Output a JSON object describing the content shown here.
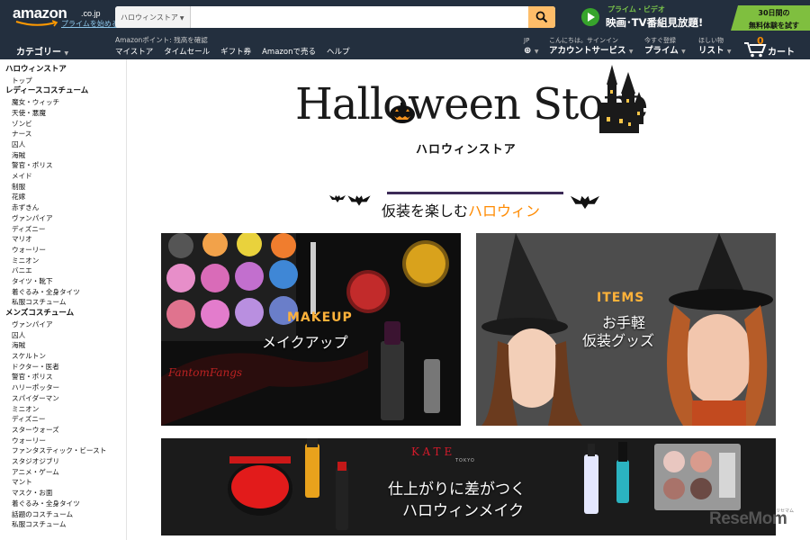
{
  "header": {
    "logo_text": "amazon",
    "logo_suffix": ".co.jp",
    "logo_prime_link": "プライムを始める",
    "search": {
      "category": "ハロウィンストア",
      "placeholder": ""
    },
    "prime_video": {
      "line1": "プライム・ビデオ",
      "line2": "映画･TV番組見放題!"
    },
    "trial": {
      "line1": "30日間の",
      "line2": "無料体験を試す"
    }
  },
  "subnav": {
    "category_label": "カテゴリー",
    "points_text": "Amazonポイント: 残高を確認",
    "links": [
      "マイストア",
      "タイムセール",
      "ギフト券",
      "Amazonで売る",
      "ヘルプ"
    ],
    "lang": {
      "line1": "JP",
      "line2": ""
    },
    "account": {
      "line1": "こんにちは。サインイン",
      "line2": "アカウントサービス"
    },
    "prime": {
      "line1": "今すぐ登録",
      "line2": "プライム"
    },
    "wishlist": {
      "line1": "ほしい物",
      "line2": "リスト"
    },
    "cart": {
      "count": "0",
      "label": "カート"
    }
  },
  "sidebar": {
    "sections": [
      {
        "title": "ハロウィンストア",
        "items": [
          "トップ"
        ]
      },
      {
        "title": "レディースコスチューム",
        "items": [
          "魔女・ウィッチ",
          "天使・悪魔",
          "ゾンビ",
          "ナース",
          "囚人",
          "海賊",
          "警官・ポリス",
          "メイド",
          "制服",
          "花嫁",
          "赤ずきん",
          "ヴァンパイア",
          "ディズニー",
          "マリオ",
          "ウォーリー",
          "ミニオン",
          "バニエ",
          "タイツ・靴下",
          "着ぐるみ・全身タイツ",
          "私服コスチューム"
        ]
      },
      {
        "title": "メンズコスチューム",
        "items": [
          "ヴァンパイア",
          "囚人",
          "海賊",
          "スケルトン",
          "ドクター・医者",
          "警官・ポリス",
          "ハリーポッター",
          "スパイダーマン",
          "ミニオン",
          "ディズニー",
          "スターウォーズ",
          "ウォーリー",
          "ファンタスティック・ビースト",
          "スタジオジブリ",
          "アニメ・ゲーム",
          "マント",
          "マスク・お面",
          "着ぐるみ・全身タイツ",
          "話題のコスチューム",
          "私服コスチューム"
        ]
      }
    ]
  },
  "main": {
    "hero_title": "Halloween Store",
    "hero_subtitle": "ハロウィンストア",
    "tagline_prefix": "仮装を楽しむ",
    "tagline_highlight": "ハロウィン",
    "cards": {
      "makeup": {
        "en": "MAKEUP",
        "jp": "メイクアップ",
        "brand": "FantomFangs"
      },
      "items": {
        "en": "ITEMS",
        "jp_line1": "お手軽",
        "jp_line2": "仮装グッズ"
      },
      "kate": {
        "brand": "KATE",
        "brand_sub": "TOKYO",
        "jp_line1": "仕上がりに差がつく",
        "jp_line2": "ハロウィンメイク"
      }
    }
  },
  "watermark": {
    "text": "ReseMom",
    "small": "リセマム"
  },
  "colors": {
    "nav_bg": "#232f3e",
    "search_button": "#febd69",
    "accent_orange": "#ff8a00",
    "prime_green": "#7fbf3f"
  }
}
